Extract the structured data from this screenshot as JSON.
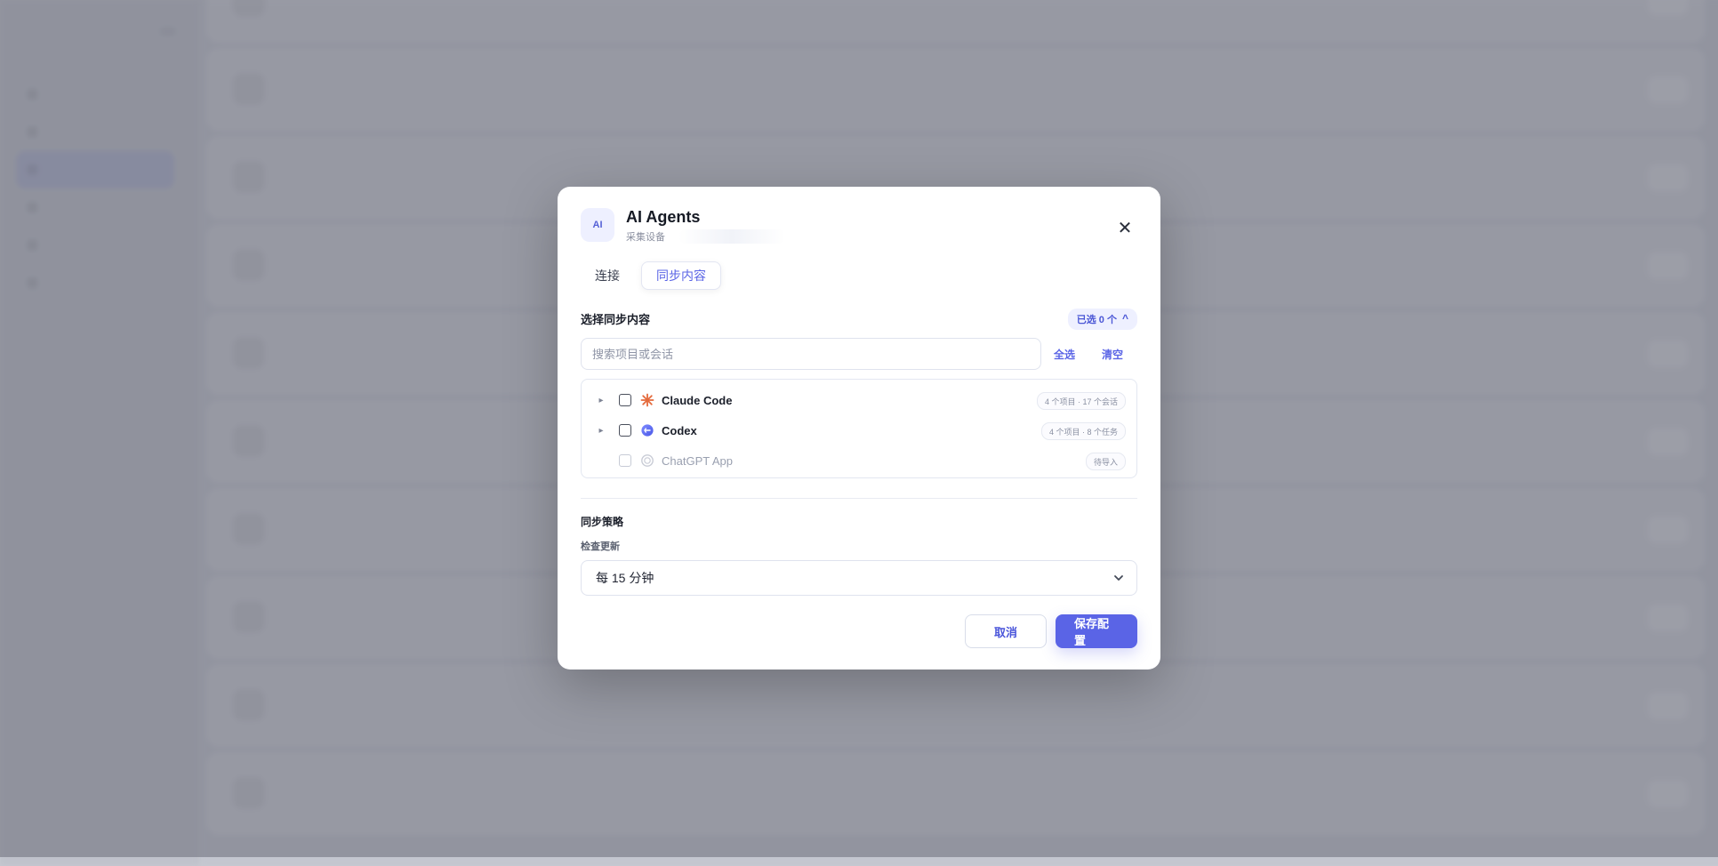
{
  "modal": {
    "app_badge": "AI",
    "title": "AI Agents",
    "subtitle": "采集设备",
    "tabs": [
      {
        "label": "连接",
        "active": false
      },
      {
        "label": "同步内容",
        "active": true
      }
    ],
    "section_title": "选择同步内容",
    "selected_pill": {
      "text": "已选 0 个",
      "caret": "^"
    },
    "search": {
      "placeholder": "搜索项目或会话",
      "value": ""
    },
    "actions": {
      "select_all": "全选",
      "clear": "清空"
    },
    "sources": [
      {
        "name": "Claude Code",
        "icon": "claude-icon",
        "expandable": true,
        "checked": false,
        "meta": "4 个项目 · 17 个会话",
        "disabled": false
      },
      {
        "name": "Codex",
        "icon": "codex-icon",
        "expandable": true,
        "checked": false,
        "meta": "4 个项目 · 8 个任务",
        "disabled": false
      },
      {
        "name": "ChatGPT App",
        "icon": "chatgpt-icon",
        "expandable": false,
        "checked": false,
        "meta": "待导入",
        "disabled": true
      }
    ],
    "policy": {
      "title": "同步策略",
      "label": "检查更新",
      "selected": "每 15 分钟"
    },
    "buttons": {
      "cancel": "取消",
      "save": "保存配置"
    },
    "colors": {
      "primary": "#5a64e6",
      "overlay": "rgba(105,108,120,0.55)"
    }
  }
}
